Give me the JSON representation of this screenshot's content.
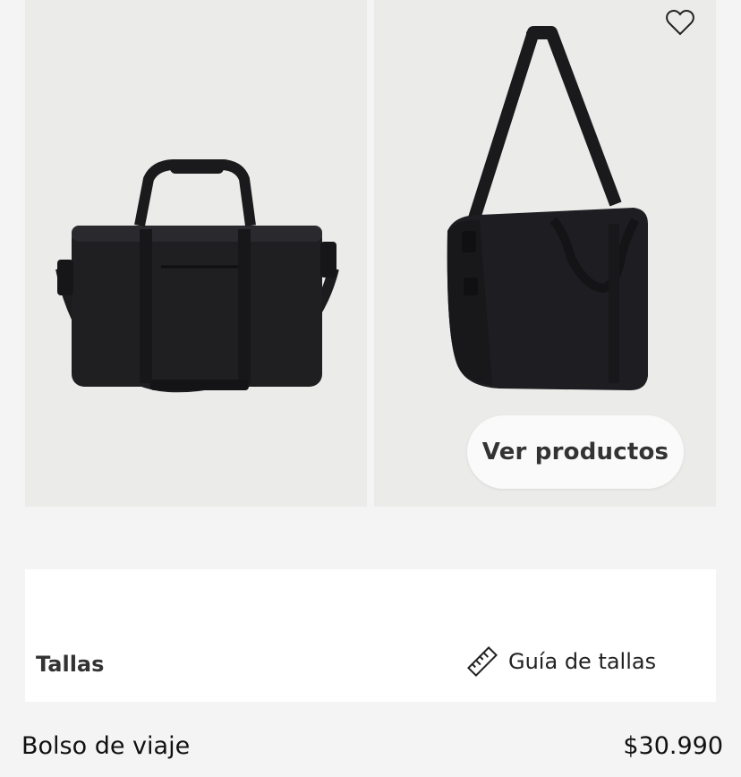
{
  "gallery": {
    "favorite_icon": "heart-outline-icon",
    "cta_label": "Ver productos"
  },
  "sizes": {
    "label": "Tallas",
    "guide_label": "Guía de tallas",
    "guide_icon": "ruler-icon"
  },
  "product": {
    "name": "Bolso de viaje",
    "price": "$30.990"
  }
}
